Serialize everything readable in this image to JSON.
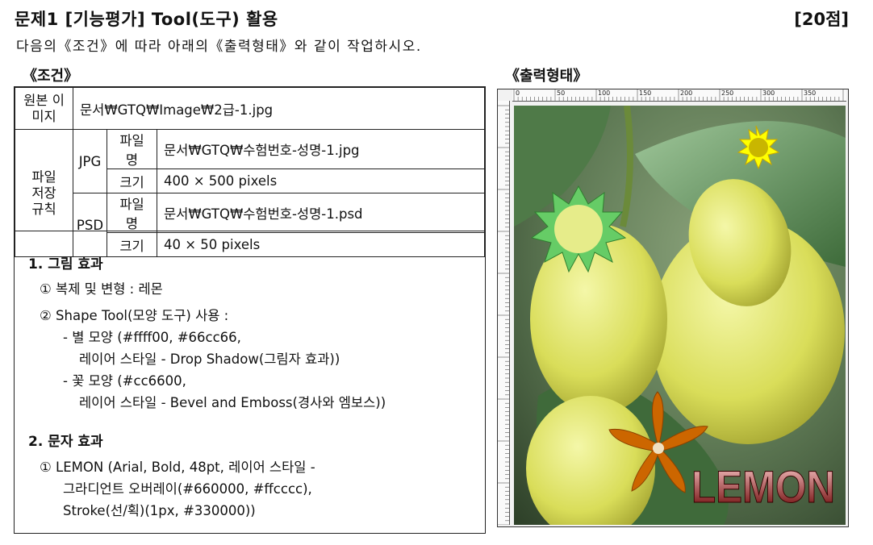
{
  "header": {
    "title": "문제1 [기능평가] Tool(도구) 활용",
    "score": "[20점]",
    "instruction": "다음의《조건》에 따라 아래의《출력형태》와 같이 작업하시오."
  },
  "headings": {
    "conditions": "《조건》",
    "output": "《출력형태》"
  },
  "spec": {
    "source_label": "원본 이미지",
    "source_value": "문서₩GTQ₩Image₩2급-1.jpg",
    "save_label": "파일 저장 규칙",
    "jpg": {
      "type": "JPG",
      "name_label": "파일명",
      "name": "문서₩GTQ₩수험번호-성명-1.jpg",
      "size_label": "크기",
      "size": "400 × 500 pixels"
    },
    "psd": {
      "type": "PSD",
      "name_label": "파일명",
      "name": "문서₩GTQ₩수험번호-성명-1.psd",
      "size_label": "크기",
      "size": "40 × 50 pixels"
    }
  },
  "conditions": {
    "s1_title": "1. 그림 효과",
    "s1_1": "① 복제 및 변형 : 레몬",
    "s1_2": "② Shape Tool(모양 도구) 사용 :",
    "s1_2a": "- 별 모양 (#ffff00, #66cc66,",
    "s1_2b": "레이어 스타일 - Drop Shadow(그림자 효과))",
    "s1_2c": "- 꽃 모양 (#cc6600,",
    "s1_2d": "레이어 스타일 - Bevel and Emboss(경사와 엠보스))",
    "s2_title": "2. 문자 효과",
    "s2_1": "① LEMON (Arial, Bold, 48pt, 레이어 스타일 -",
    "s2_1b": "그라디언트 오버레이(#660000, #ffcccc),",
    "s2_1c": "Stroke(선/획)(1px, #330000))"
  },
  "output_image": {
    "ruler_labels": [
      "0",
      "50",
      "100",
      "150",
      "200",
      "250",
      "300",
      "350"
    ],
    "text": "LEMON",
    "colors": {
      "star_yellow": "#ffff00",
      "star_green": "#66cc66",
      "flower": "#cc6600"
    }
  }
}
